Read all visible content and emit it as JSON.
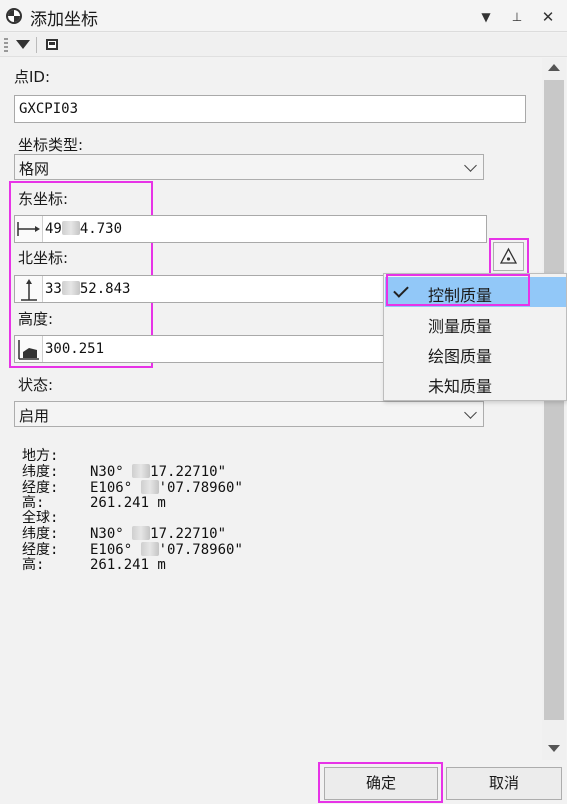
{
  "window": {
    "title": "添加坐标",
    "controls": [
      "chevron-down-icon",
      "pin-icon",
      "close-icon"
    ]
  },
  "form": {
    "point_id_label": "点ID:",
    "point_id_value": "GXCPI03",
    "coord_type_label": "坐标类型:",
    "coord_type_value": "格网",
    "east_label": "东坐标:",
    "east_value": "49",
    "east_value_tail": "4.730",
    "north_label": "北坐标:",
    "north_value": "33",
    "north_value_tail": "52.843",
    "height_label": "高度:",
    "height_value": "300.251",
    "status_label": "状态:",
    "status_value": "启用"
  },
  "quality_menu": {
    "items": [
      {
        "label": "控制质量",
        "checked": true
      },
      {
        "label": "测量质量",
        "checked": false
      },
      {
        "label": "绘图质量",
        "checked": false
      },
      {
        "label": "未知质量",
        "checked": false
      }
    ]
  },
  "info": {
    "local_header": "地方:",
    "local_lat_label": "纬度:",
    "local_lat_a": "N30°",
    "local_lat_b": "17.22710\"",
    "local_lon_label": "经度:",
    "local_lon_a": "E106°",
    "local_lon_b": "'07.78960\"",
    "local_h_label": "高:",
    "local_h": "261.241 m",
    "global_header": "全球:",
    "global_lat_label": "纬度:",
    "global_lat_a": "N30°",
    "global_lat_b": "17.22710\"",
    "global_lon_label": "经度:",
    "global_lon_a": "E106°",
    "global_lon_b": "'07.78960\"",
    "global_h_label": "高:",
    "global_h": "261.241 m"
  },
  "buttons": {
    "ok": "确定",
    "cancel": "取消"
  },
  "colors": {
    "highlight": "#e733e7",
    "menu_selected": "#92c8f8"
  }
}
